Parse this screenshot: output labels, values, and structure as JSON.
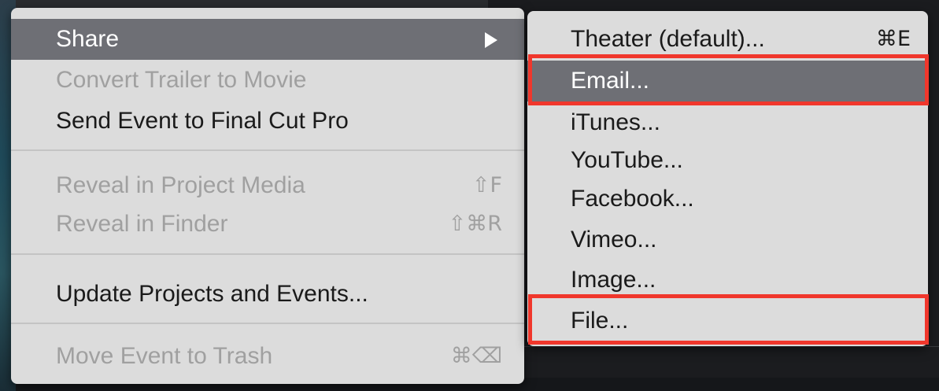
{
  "context_menu": {
    "items": [
      {
        "label": "Share",
        "shortcut": "",
        "state": "highlighted",
        "has_submenu": true
      },
      {
        "label": "Convert Trailer to Movie",
        "shortcut": "",
        "state": "disabled"
      },
      {
        "label": "Send Event to Final Cut Pro",
        "shortcut": "",
        "state": "enabled"
      },
      {
        "label": "Reveal in Project Media",
        "shortcut": "⇧F",
        "state": "disabled"
      },
      {
        "label": "Reveal in Finder",
        "shortcut": "⇧⌘R",
        "state": "disabled"
      },
      {
        "label": "Update Projects and Events...",
        "shortcut": "",
        "state": "enabled"
      },
      {
        "label": "Move Event to Trash",
        "shortcut": "⌘⌫",
        "state": "disabled"
      }
    ],
    "submenu_arrow_icon": "triangle-right-icon"
  },
  "share_submenu": {
    "items": [
      {
        "label": "Theater (default)...",
        "shortcut": "⌘E",
        "state": "enabled"
      },
      {
        "label": "Email...",
        "shortcut": "",
        "state": "highlighted"
      },
      {
        "label": "iTunes...",
        "shortcut": "",
        "state": "enabled"
      },
      {
        "label": "YouTube...",
        "shortcut": "",
        "state": "enabled"
      },
      {
        "label": "Facebook...",
        "shortcut": "",
        "state": "enabled"
      },
      {
        "label": "Vimeo...",
        "shortcut": "",
        "state": "enabled"
      },
      {
        "label": "Image...",
        "shortcut": "",
        "state": "enabled"
      },
      {
        "label": "File...",
        "shortcut": "",
        "state": "enabled"
      }
    ]
  },
  "annotations": {
    "highlighted_items": [
      "Email...",
      "File..."
    ],
    "color": "#f0372c"
  },
  "colors": {
    "menu_background": "#dcdcdc",
    "highlight_background": "#6e6f75",
    "disabled_text": "#a0a0a0",
    "annotation_border": "#f0372c"
  }
}
